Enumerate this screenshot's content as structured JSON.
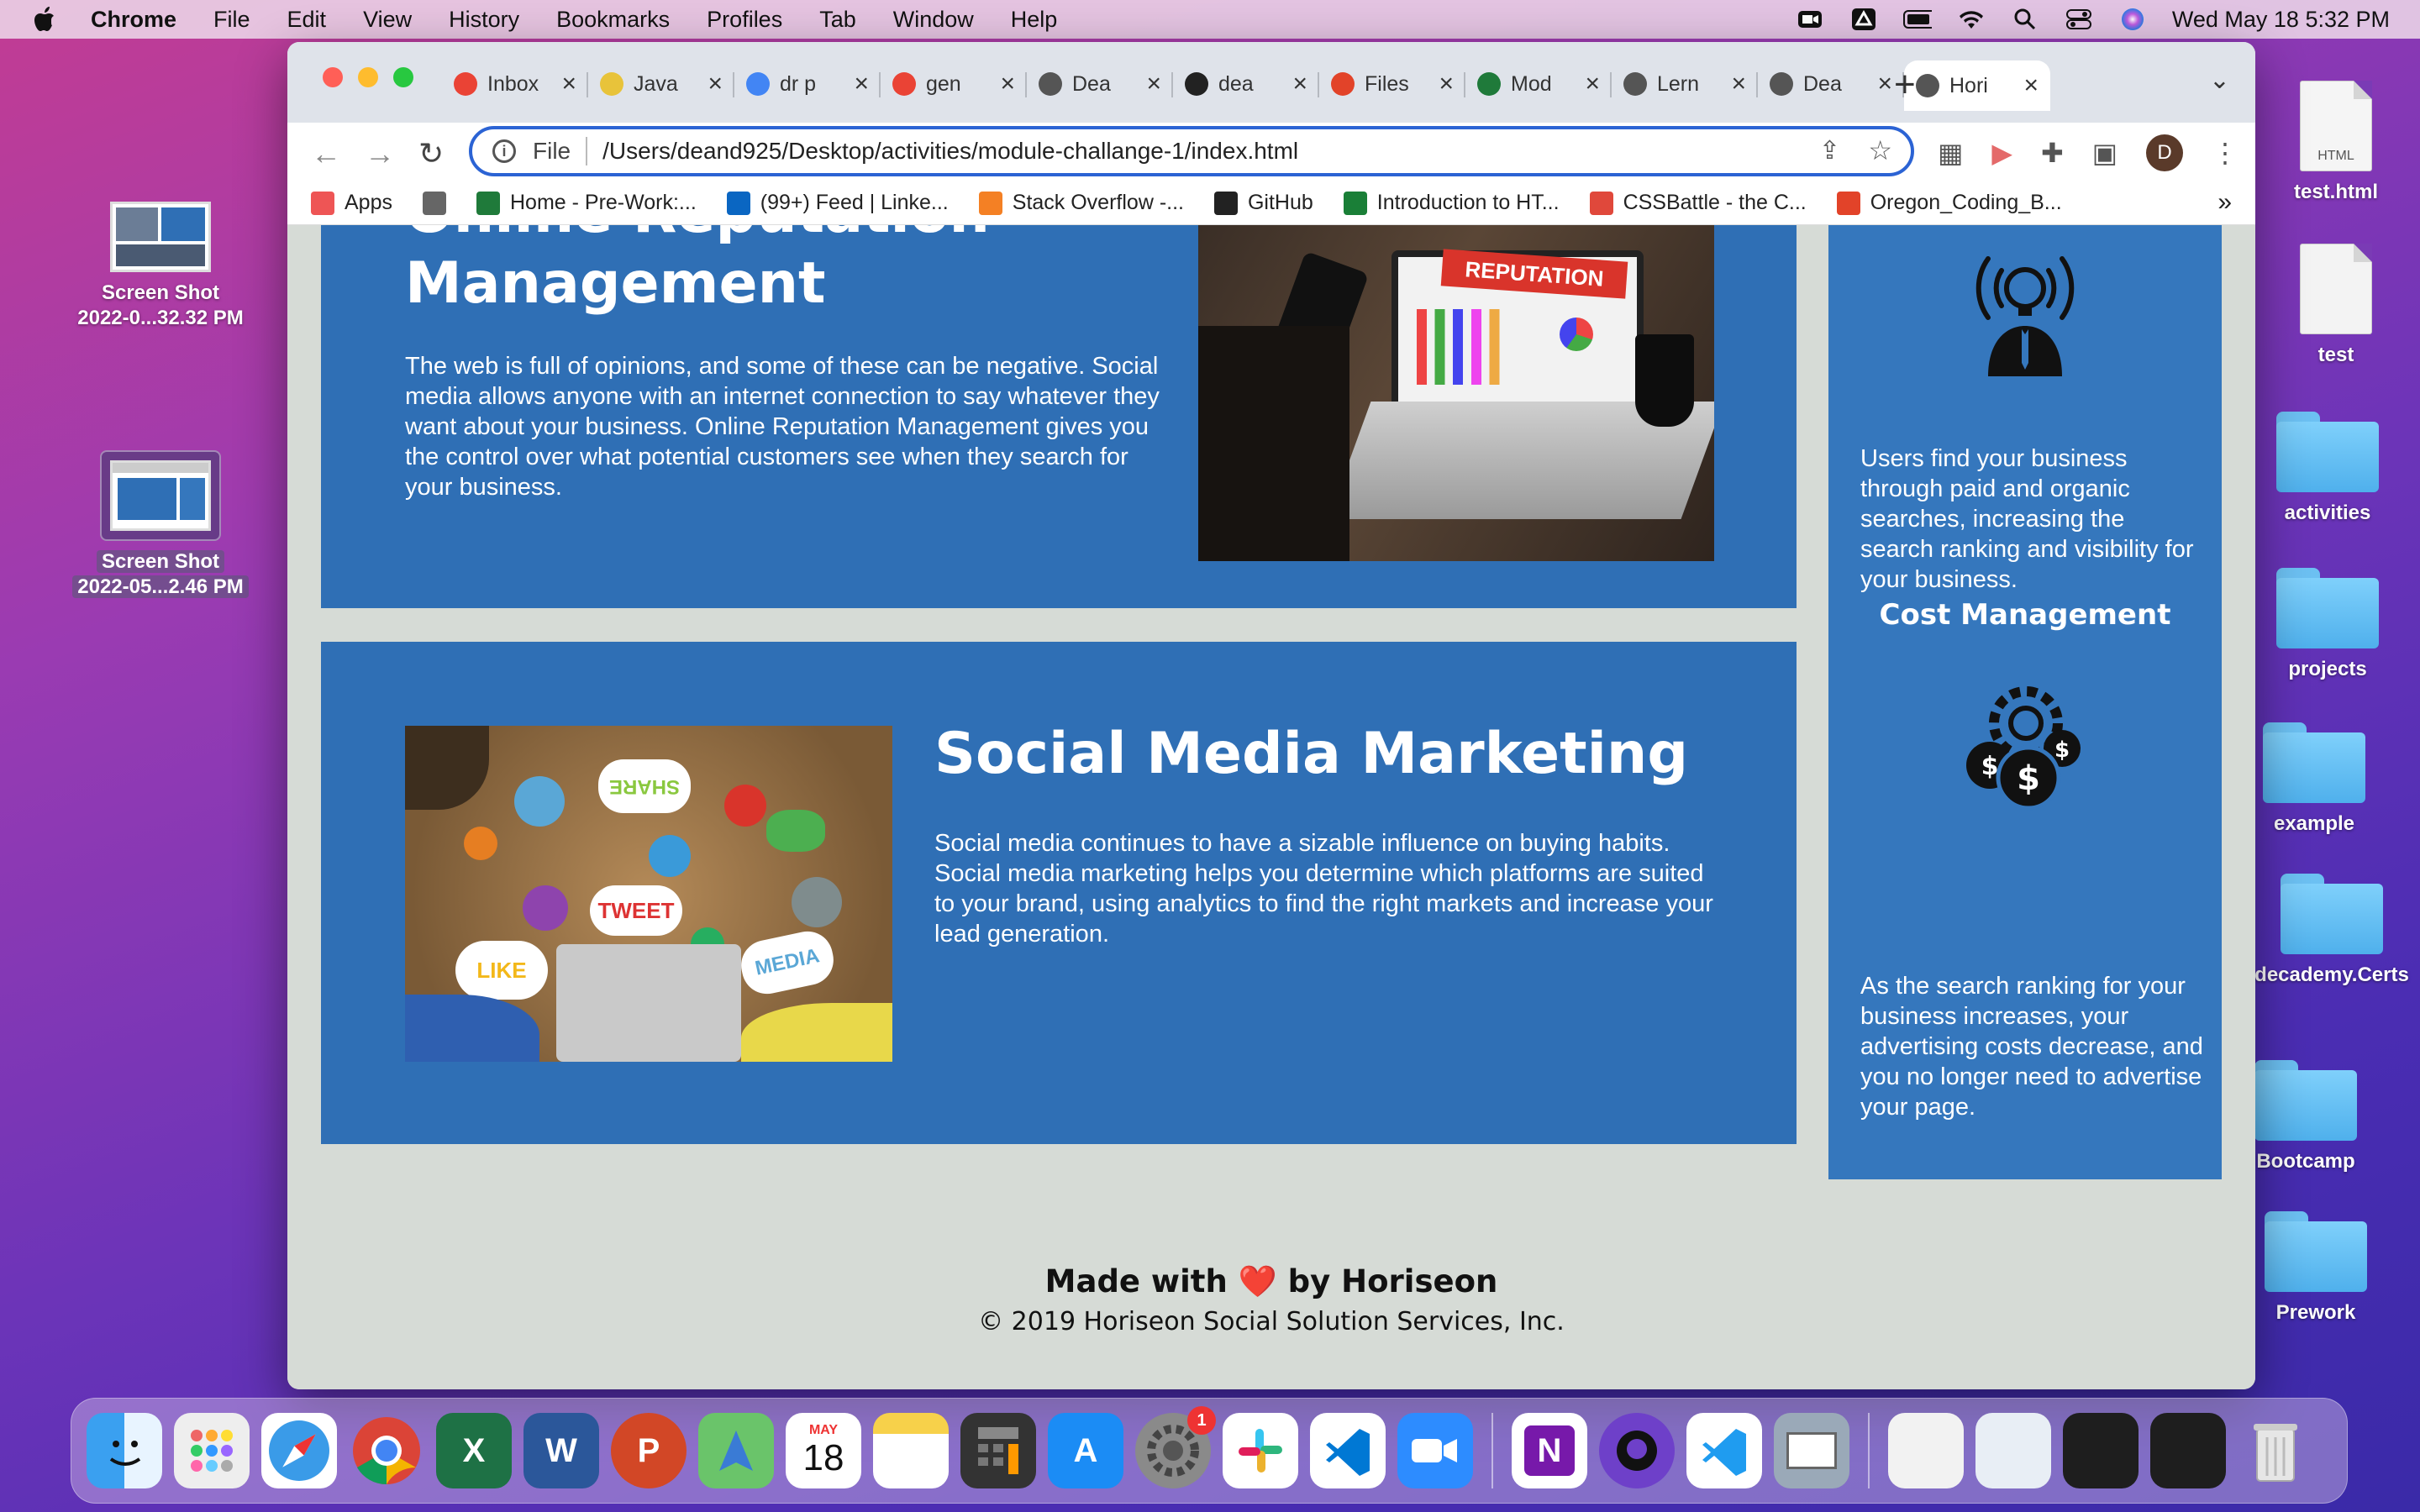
{
  "menubar": {
    "app": "Chrome",
    "items": [
      "File",
      "Edit",
      "View",
      "History",
      "Bookmarks",
      "Profiles",
      "Tab",
      "Window",
      "Help"
    ],
    "clock": "Wed May 18  5:32 PM"
  },
  "desktop": {
    "left_icons": [
      {
        "line1": "Screen Shot",
        "line2": "2022-0...32.32 PM"
      },
      {
        "line1": "Screen Shot",
        "line2": "2022-05...2.46 PM"
      }
    ],
    "right_icons": [
      "test.html",
      "test",
      "activities",
      "projects",
      "example",
      "decademy.Certs",
      "Bootcamp",
      "Prework"
    ],
    "html_badge": "HTML"
  },
  "browser": {
    "tabs": [
      {
        "title": "Inbox",
        "icon": "gmail-icon",
        "color": "#ea4335"
      },
      {
        "title": "Java",
        "icon": "js-icon",
        "color": "#e8c33a"
      },
      {
        "title": "dr p",
        "icon": "google-icon",
        "color": "#4285f4"
      },
      {
        "title": "gen",
        "icon": "google-chrome-icon",
        "color": "#ea4335"
      },
      {
        "title": "Dea",
        "icon": "globe-icon",
        "color": "#555555"
      },
      {
        "title": "dea",
        "icon": "github-icon",
        "color": "#222222"
      },
      {
        "title": "Files",
        "icon": "gitlab-icon",
        "color": "#e24329"
      },
      {
        "title": "Mod",
        "icon": "o-icon",
        "color": "#1f7a3a"
      },
      {
        "title": "Lern",
        "icon": "globe-icon",
        "color": "#555555"
      },
      {
        "title": "Dea",
        "icon": "globe-icon",
        "color": "#555555"
      },
      {
        "title": "Hori",
        "icon": "globe-icon",
        "color": "#555555"
      }
    ],
    "address": {
      "scheme_label": "File",
      "url": "/Users/deand925/Desktop/activities/module-challange-1/index.html"
    },
    "profile_initial": "D",
    "bookmarks": [
      {
        "label": "Apps",
        "color": "#e55"
      },
      {
        "label": "",
        "color": "#666"
      },
      {
        "label": "Home - Pre-Work:...",
        "color": "#1f7a3a"
      },
      {
        "label": "(99+) Feed | Linke...",
        "color": "#0a66c2"
      },
      {
        "label": "Stack Overflow -...",
        "color": "#f48024"
      },
      {
        "label": "GitHub",
        "color": "#222"
      },
      {
        "label": "Introduction to HT...",
        "color": "#1a7f37"
      },
      {
        "label": "CSSBattle - the C...",
        "color": "#e0483b"
      },
      {
        "label": "Oregon_Coding_B...",
        "color": "#e24329"
      }
    ],
    "bookmarks_more": "»"
  },
  "page": {
    "orm": {
      "title_line1": "Online Reputation",
      "title_line2": "Management",
      "text": "The web is full of opinions, and some of these can be negative. Social media allows anyone with an internet connection to say whatever they want about your business. Online Reputation Management gives you the control over what potential customers see when they search for your business.",
      "image_label": "REPUTATION"
    },
    "smm": {
      "title": "Social Media Marketing",
      "text": "Social media continues to have a sizable influence on buying habits. Social media marketing helps you determine which platforms are suited to your brand, using analytics to find the right markets and increase your lead generation.",
      "bubbles": [
        "SHARE",
        "TWEET",
        "LIKE",
        "MEDIA"
      ]
    },
    "aside": {
      "lead_text": "Users find your business through paid and organic searches, increasing the search ranking and visibility for your business.",
      "cost_title": "Cost Management",
      "cost_text": "As the search ranking for your business increases, your advertising costs decrease, and you no longer need to advertise your page."
    },
    "footer": {
      "made_prefix": "Made with",
      "heart": "❤️",
      "made_suffix": "by Horiseon",
      "copyright": "© 2019 Horiseon Social Solution Services, Inc."
    }
  },
  "dock": {
    "calendar_month": "MAY",
    "calendar_day": "18",
    "settings_badge": "1"
  },
  "colors": {
    "page_bg": "#d6dbd6",
    "section_blue": "#2f6fb5",
    "aside_blue": "#3577bd",
    "omnibox_focus": "#2b63d4"
  }
}
